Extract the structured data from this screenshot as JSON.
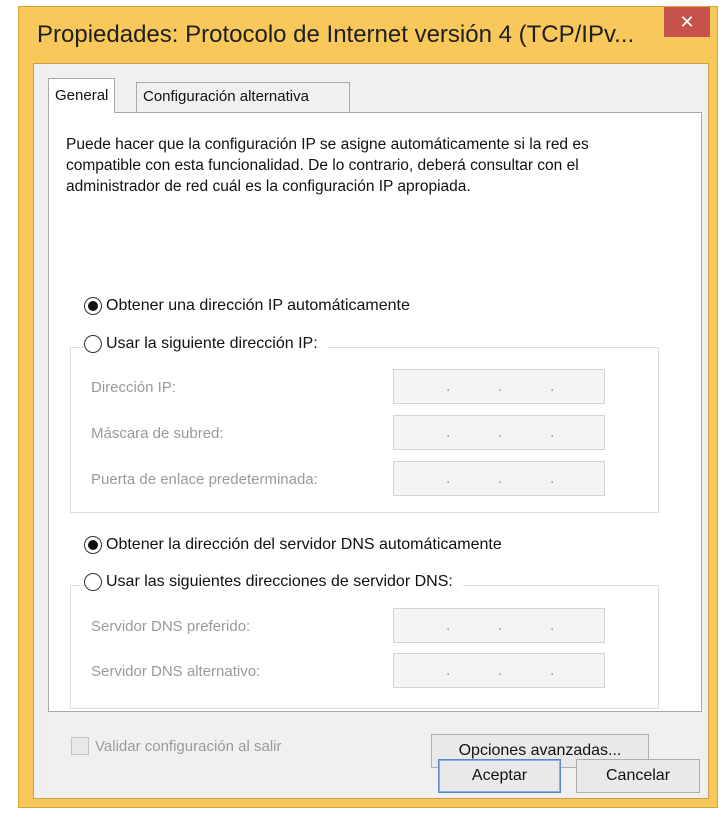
{
  "window": {
    "title": "Propiedades: Protocolo de Internet versión 4 (TCP/IPv...",
    "close_label": "✕"
  },
  "tabs": [
    {
      "label": "General",
      "selected": true
    },
    {
      "label": "Configuración alternativa",
      "selected": false
    }
  ],
  "description": "Puede hacer que la configuración IP se asigne automáticamente si la red es compatible con esta funcionalidad. De lo contrario, deberá consultar con el administrador de red cuál es la configuración IP apropiada.",
  "ip_options": {
    "auto": {
      "label": "Obtener una dirección IP automáticamente",
      "checked": true
    },
    "manual": {
      "label": "Usar la siguiente dirección IP:",
      "checked": false
    }
  },
  "ip_fields": [
    {
      "label": "Dirección IP:",
      "value": ".    .    ."
    },
    {
      "label": "Máscara de subred:",
      "value": ".    .    ."
    },
    {
      "label": "Puerta de enlace predeterminada:",
      "value": ".    .    ."
    }
  ],
  "dns_options": {
    "auto": {
      "label": "Obtener la dirección del servidor DNS automáticamente",
      "checked": true
    },
    "manual": {
      "label": "Usar las siguientes direcciones de servidor DNS:",
      "checked": false
    }
  },
  "dns_fields": [
    {
      "label": "Servidor DNS preferido:",
      "value": ".    .    ."
    },
    {
      "label": "Servidor DNS alternativo:",
      "value": ".    .    ."
    }
  ],
  "validate": {
    "label": "Validar configuración al salir",
    "checked": false,
    "enabled": false
  },
  "buttons": {
    "advanced": "Opciones avanzadas...",
    "ok": "Aceptar",
    "cancel": "Cancelar"
  },
  "colors": {
    "title_bar": "#f8c85a",
    "close_button": "#c7514b",
    "disabled_text": "#9a9a9a"
  }
}
